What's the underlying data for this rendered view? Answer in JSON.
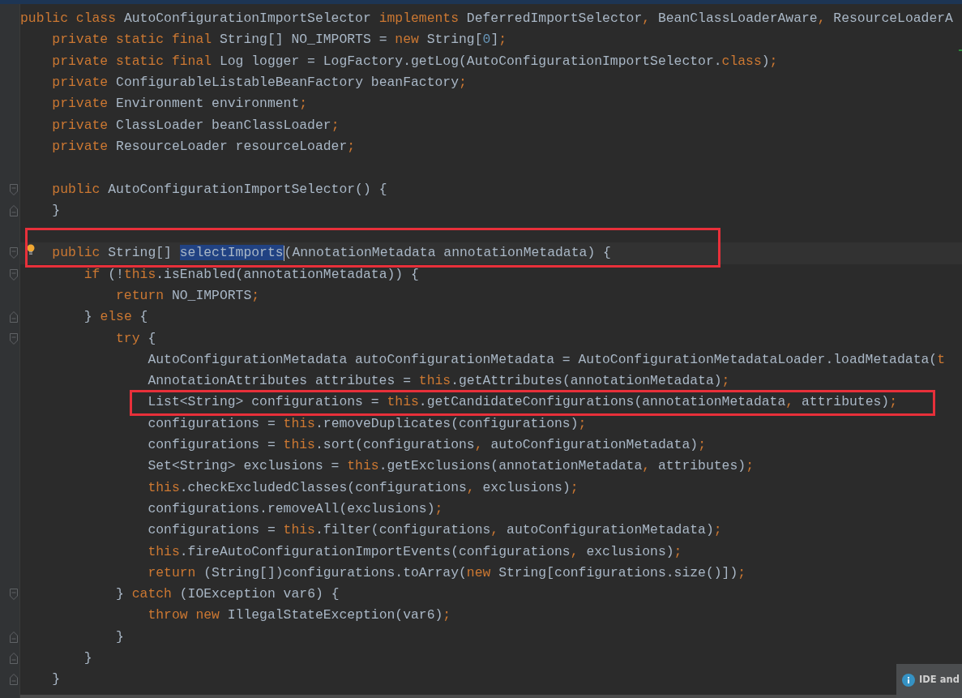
{
  "editor": {
    "lines": [
      {
        "kind": "code",
        "segments": [
          {
            "kind": "keyword",
            "t": "public class "
          },
          {
            "kind": "text",
            "t": "AutoConfigurationImportSelector "
          },
          {
            "kind": "keyword",
            "t": "implements "
          },
          {
            "kind": "text",
            "t": "DeferredImportSelector"
          },
          {
            "kind": "keyword",
            "t": ", "
          },
          {
            "kind": "text",
            "t": "BeanClassLoaderAware"
          },
          {
            "kind": "keyword",
            "t": ", "
          },
          {
            "kind": "text",
            "t": "ResourceLoaderA"
          }
        ]
      },
      {
        "kind": "code",
        "segments": [
          {
            "kind": "keyword",
            "t": "    private static final "
          },
          {
            "kind": "text",
            "t": "String[] NO_IMPORTS = "
          },
          {
            "kind": "keyword",
            "t": "new "
          },
          {
            "kind": "text",
            "t": "String["
          },
          {
            "kind": "number",
            "t": "0"
          },
          {
            "kind": "text",
            "t": "]"
          },
          {
            "kind": "keyword",
            "t": ";"
          }
        ]
      },
      {
        "kind": "code",
        "segments": [
          {
            "kind": "keyword",
            "t": "    private static final "
          },
          {
            "kind": "text",
            "t": "Log logger = LogFactory.getLog(AutoConfigurationImportSelector."
          },
          {
            "kind": "keyword",
            "t": "class"
          },
          {
            "kind": "text",
            "t": ")"
          },
          {
            "kind": "keyword",
            "t": ";"
          }
        ]
      },
      {
        "kind": "code",
        "segments": [
          {
            "kind": "keyword",
            "t": "    private "
          },
          {
            "kind": "text",
            "t": "ConfigurableListableBeanFactory beanFactory"
          },
          {
            "kind": "keyword",
            "t": ";"
          }
        ]
      },
      {
        "kind": "code",
        "segments": [
          {
            "kind": "keyword",
            "t": "    private "
          },
          {
            "kind": "text",
            "t": "Environment environment"
          },
          {
            "kind": "keyword",
            "t": ";"
          }
        ]
      },
      {
        "kind": "code",
        "segments": [
          {
            "kind": "keyword",
            "t": "    private "
          },
          {
            "kind": "text",
            "t": "ClassLoader beanClassLoader"
          },
          {
            "kind": "keyword",
            "t": ";"
          }
        ]
      },
      {
        "kind": "code",
        "segments": [
          {
            "kind": "keyword",
            "t": "    private "
          },
          {
            "kind": "text",
            "t": "ResourceLoader resourceLoader"
          },
          {
            "kind": "keyword",
            "t": ";"
          }
        ]
      },
      {
        "kind": "blank"
      },
      {
        "kind": "code",
        "fold": {
          "kind": "open"
        },
        "segments": [
          {
            "kind": "keyword",
            "t": "    public "
          },
          {
            "kind": "text",
            "t": "AutoConfigurationImportSelector() {"
          }
        ]
      },
      {
        "kind": "code",
        "fold": {
          "kind": "close"
        },
        "segments": [
          {
            "kind": "text",
            "t": "    }"
          }
        ]
      },
      {
        "kind": "blank"
      },
      {
        "kind": "code",
        "fold": {
          "kind": "open"
        },
        "bulb": true,
        "current": true,
        "box": {
          "kind": "wide"
        },
        "segments": [
          {
            "kind": "keyword",
            "t": "    public "
          },
          {
            "kind": "text",
            "t": "String[] "
          },
          {
            "kind": "selected",
            "t": "selectImports",
            "caret": true
          },
          {
            "kind": "text",
            "t": "(AnnotationMetadata annotationMetadata) {"
          }
        ]
      },
      {
        "kind": "code",
        "fold": {
          "kind": "open"
        },
        "segments": [
          {
            "kind": "keyword",
            "t": "        if "
          },
          {
            "kind": "text",
            "t": "(!"
          },
          {
            "kind": "keyword",
            "t": "this"
          },
          {
            "kind": "text",
            "t": ".isEnabled(annotationMetadata)) {"
          }
        ]
      },
      {
        "kind": "code",
        "segments": [
          {
            "kind": "keyword",
            "t": "            return "
          },
          {
            "kind": "text",
            "t": "NO_IMPORTS"
          },
          {
            "kind": "keyword",
            "t": ";"
          }
        ]
      },
      {
        "kind": "code",
        "fold": {
          "kind": "close"
        },
        "segments": [
          {
            "kind": "text",
            "t": "        } "
          },
          {
            "kind": "keyword",
            "t": "else "
          },
          {
            "kind": "text",
            "t": "{"
          }
        ]
      },
      {
        "kind": "code",
        "fold": {
          "kind": "open"
        },
        "segments": [
          {
            "kind": "keyword",
            "t": "            try "
          },
          {
            "kind": "text",
            "t": "{"
          }
        ]
      },
      {
        "kind": "code",
        "segments": [
          {
            "kind": "text",
            "t": "                AutoConfigurationMetadata autoConfigurationMetadata = AutoConfigurationMetadataLoader.loadMetadata("
          },
          {
            "kind": "keyword",
            "t": "t"
          }
        ]
      },
      {
        "kind": "code",
        "segments": [
          {
            "kind": "text",
            "t": "                AnnotationAttributes attributes = "
          },
          {
            "kind": "keyword",
            "t": "this"
          },
          {
            "kind": "text",
            "t": ".getAttributes(annotationMetadata)"
          },
          {
            "kind": "keyword",
            "t": ";"
          }
        ]
      },
      {
        "kind": "code",
        "box": {
          "kind": "code"
        },
        "segments": [
          {
            "kind": "text",
            "t": "                List<String> configurations = "
          },
          {
            "kind": "keyword",
            "t": "this"
          },
          {
            "kind": "text",
            "t": ".getCandidateConfigurations(annotationMetadata"
          },
          {
            "kind": "keyword",
            "t": ", "
          },
          {
            "kind": "text",
            "t": "attributes)"
          },
          {
            "kind": "keyword",
            "t": ";"
          }
        ]
      },
      {
        "kind": "code",
        "segments": [
          {
            "kind": "text",
            "t": "                configurations = "
          },
          {
            "kind": "keyword",
            "t": "this"
          },
          {
            "kind": "text",
            "t": ".removeDuplicates(configurations)"
          },
          {
            "kind": "keyword",
            "t": ";"
          }
        ]
      },
      {
        "kind": "code",
        "segments": [
          {
            "kind": "text",
            "t": "                configurations = "
          },
          {
            "kind": "keyword",
            "t": "this"
          },
          {
            "kind": "text",
            "t": ".sort(configurations"
          },
          {
            "kind": "keyword",
            "t": ", "
          },
          {
            "kind": "text",
            "t": "autoConfigurationMetadata)"
          },
          {
            "kind": "keyword",
            "t": ";"
          }
        ]
      },
      {
        "kind": "code",
        "segments": [
          {
            "kind": "text",
            "t": "                Set<String> exclusions = "
          },
          {
            "kind": "keyword",
            "t": "this"
          },
          {
            "kind": "text",
            "t": ".getExclusions(annotationMetadata"
          },
          {
            "kind": "keyword",
            "t": ", "
          },
          {
            "kind": "text",
            "t": "attributes)"
          },
          {
            "kind": "keyword",
            "t": ";"
          }
        ]
      },
      {
        "kind": "code",
        "segments": [
          {
            "kind": "keyword",
            "t": "                this"
          },
          {
            "kind": "text",
            "t": ".checkExcludedClasses(configurations"
          },
          {
            "kind": "keyword",
            "t": ", "
          },
          {
            "kind": "text",
            "t": "exclusions)"
          },
          {
            "kind": "keyword",
            "t": ";"
          }
        ]
      },
      {
        "kind": "code",
        "segments": [
          {
            "kind": "text",
            "t": "                configurations.removeAll(exclusions)"
          },
          {
            "kind": "keyword",
            "t": ";"
          }
        ]
      },
      {
        "kind": "code",
        "segments": [
          {
            "kind": "text",
            "t": "                configurations = "
          },
          {
            "kind": "keyword",
            "t": "this"
          },
          {
            "kind": "text",
            "t": ".filter(configurations"
          },
          {
            "kind": "keyword",
            "t": ", "
          },
          {
            "kind": "text",
            "t": "autoConfigurationMetadata)"
          },
          {
            "kind": "keyword",
            "t": ";"
          }
        ]
      },
      {
        "kind": "code",
        "segments": [
          {
            "kind": "keyword",
            "t": "                this"
          },
          {
            "kind": "text",
            "t": ".fireAutoConfigurationImportEvents(configurations"
          },
          {
            "kind": "keyword",
            "t": ", "
          },
          {
            "kind": "text",
            "t": "exclusions)"
          },
          {
            "kind": "keyword",
            "t": ";"
          }
        ]
      },
      {
        "kind": "code",
        "segments": [
          {
            "kind": "keyword",
            "t": "                return "
          },
          {
            "kind": "text",
            "t": "(String[])configurations.toArray("
          },
          {
            "kind": "keyword",
            "t": "new "
          },
          {
            "kind": "text",
            "t": "String[configurations.size()])"
          },
          {
            "kind": "keyword",
            "t": ";"
          }
        ]
      },
      {
        "kind": "code",
        "fold": {
          "kind": "open"
        },
        "segments": [
          {
            "kind": "text",
            "t": "            } "
          },
          {
            "kind": "keyword",
            "t": "catch "
          },
          {
            "kind": "text",
            "t": "(IOException var6) {"
          }
        ]
      },
      {
        "kind": "code",
        "segments": [
          {
            "kind": "keyword",
            "t": "                throw new "
          },
          {
            "kind": "text",
            "t": "IllegalStateException(var6)"
          },
          {
            "kind": "keyword",
            "t": ";"
          }
        ]
      },
      {
        "kind": "code",
        "fold": {
          "kind": "close"
        },
        "segments": [
          {
            "kind": "text",
            "t": "            }"
          }
        ]
      },
      {
        "kind": "code",
        "fold": {
          "kind": "close"
        },
        "segments": [
          {
            "kind": "text",
            "t": "        }"
          }
        ]
      },
      {
        "kind": "code",
        "fold": {
          "kind": "close"
        },
        "segments": [
          {
            "kind": "text",
            "t": "    }"
          }
        ]
      }
    ]
  },
  "notification": {
    "title": "IDE and"
  }
}
